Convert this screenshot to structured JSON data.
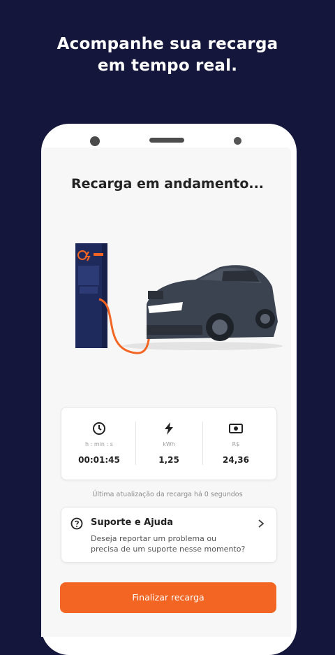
{
  "headline": {
    "line1": "Acompanhe sua recarga",
    "line2": "em tempo real."
  },
  "screen": {
    "title": "Recarga em andamento..."
  },
  "stats": [
    {
      "icon": "clock-icon",
      "label": "h : min : s",
      "value": "00:01:45"
    },
    {
      "icon": "lightning-icon",
      "label": "kWh",
      "value": "1,25"
    },
    {
      "icon": "money-icon",
      "label": "R$",
      "value": "24,36"
    }
  ],
  "update_text": "Última atualização da recarga há 0 segundos",
  "support": {
    "icon": "question-circle-icon",
    "title": "Suporte e Ajuda",
    "description": "Deseja reportar um problema ou precisa de um suporte nesse momento?"
  },
  "finish_button": "Finalizar recarga",
  "colors": {
    "background": "#14173b",
    "accent": "#f26522",
    "station": "#1f2a5c",
    "car": "#3b4350"
  }
}
